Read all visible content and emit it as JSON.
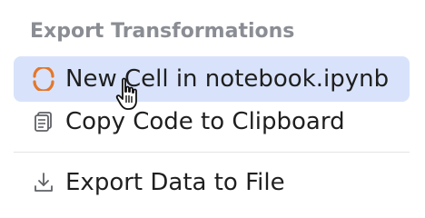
{
  "menu": {
    "header": "Export Transformations",
    "items": [
      {
        "label": "New Cell in notebook.ipynb",
        "icon": "jupyter-icon",
        "selected": true
      },
      {
        "label": "Copy Code to Clipboard",
        "icon": "copy-icon",
        "selected": false
      },
      {
        "label": "Export Data to File",
        "icon": "download-icon",
        "selected": false
      }
    ]
  },
  "colors": {
    "selected_bg": "#d8e3fb",
    "header_text": "#8a8d93",
    "jupyter_orange": "#e4772b"
  }
}
